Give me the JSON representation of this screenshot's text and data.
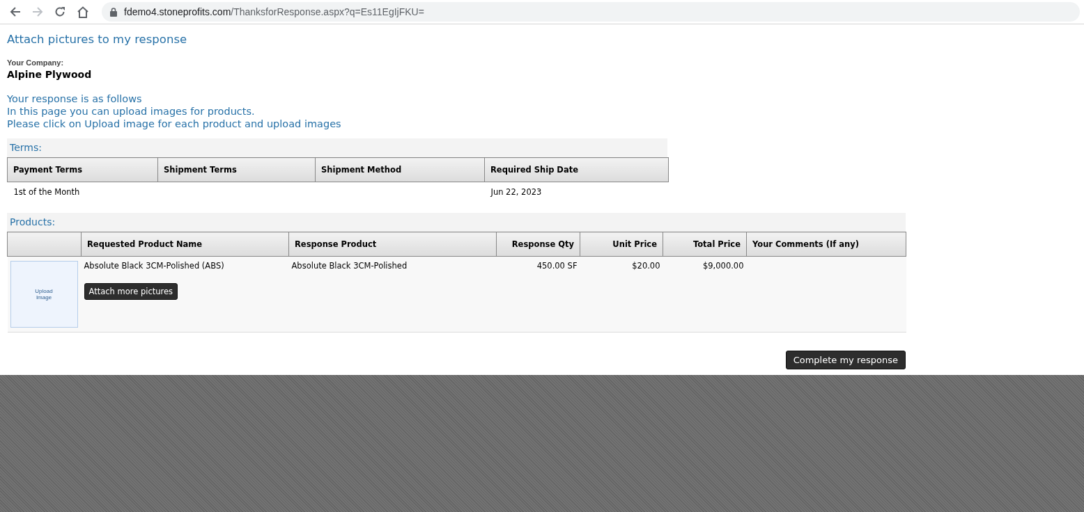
{
  "browser": {
    "url_host": "fdemo4.stoneprofits.com",
    "url_path": "/ThanksforResponse.aspx?q=Es11EgIjFKU="
  },
  "page": {
    "title": "Attach pictures to my response",
    "company_label": "Your Company:",
    "company": "Alpine Plywood",
    "messages": [
      "Your response is as follows",
      "In this page you can upload images for products.",
      "Please click on Upload image for each product and upload images"
    ]
  },
  "terms": {
    "heading": "Terms:",
    "columns": [
      "Payment Terms",
      "Shipment Terms",
      "Shipment Method",
      "Required Ship Date"
    ],
    "rows": [
      [
        "1st of the Month",
        "",
        "",
        "Jun 22, 2023"
      ]
    ]
  },
  "products": {
    "heading": "Products:",
    "columns": [
      "",
      "Requested Product Name",
      "Response Product",
      "Response Qty",
      "Unit Price",
      "Total Price",
      "Your Comments (If any)"
    ],
    "rows": [
      {
        "upload_label": "Upload Image",
        "requested": "Absolute Black 3CM-Polished (ABS)",
        "attach_button": "Attach more pictures",
        "response": "Absolute Black 3CM-Polished",
        "qty": "450.00 SF",
        "unit_price": "$20.00",
        "total_price": "$9,000.00"
      }
    ]
  },
  "complete_button": "Complete my response"
}
